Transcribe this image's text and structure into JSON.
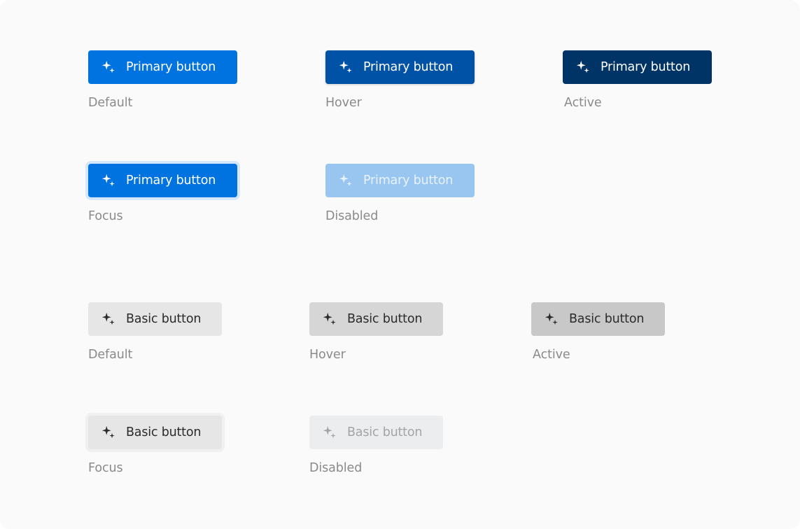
{
  "primary": {
    "label": "Primary button",
    "icon": "sparkles-icon",
    "states": [
      {
        "state": "Default",
        "color": "#0073e1"
      },
      {
        "state": "Hover",
        "color": "#0052a6"
      },
      {
        "state": "Active",
        "color": "#003366"
      },
      {
        "state": "Focus",
        "color": "#0073e1"
      },
      {
        "state": "Disabled",
        "color": "#99c6f0"
      }
    ]
  },
  "basic": {
    "label": "Basic button",
    "icon": "sparkles-icon",
    "states": [
      {
        "state": "Default",
        "color": "#e6e6e6"
      },
      {
        "state": "Hover",
        "color": "#d6d6d6"
      },
      {
        "state": "Active",
        "color": "#c8c8c8"
      },
      {
        "state": "Focus",
        "color": "#e6e6e6"
      },
      {
        "state": "Disabled",
        "color": "#ebedee"
      }
    ]
  }
}
